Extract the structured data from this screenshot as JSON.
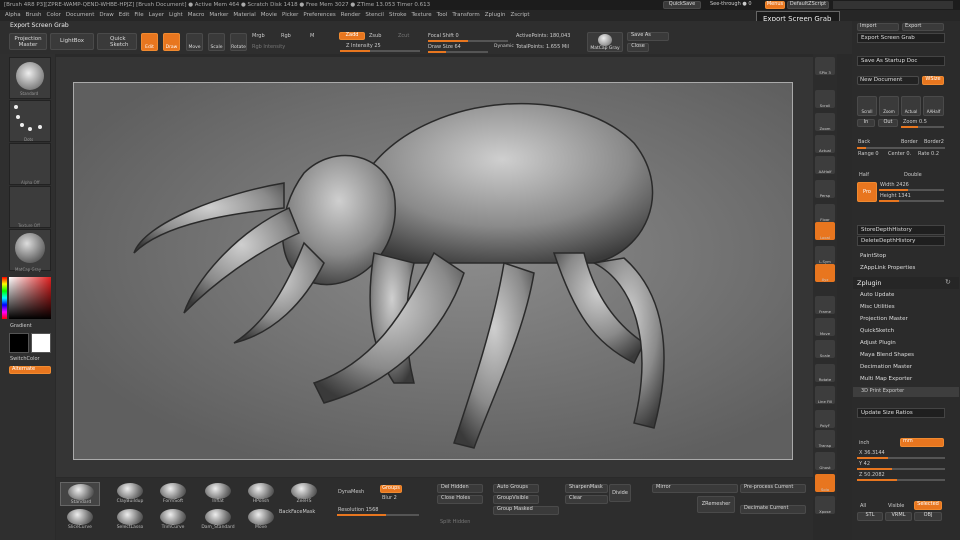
{
  "title_bar": "[Brush 4R8 P3][ZPRE-WAMP-QEND-WHBE-HPJZ]   [Brush Document]   ● Active Mem 464 ● Scratch Disk 1418 ● Free Mem 3027 ● ZTime 13.053 Timer 0.613",
  "menu": [
    "Alpha",
    "Brush",
    "Color",
    "Document",
    "Draw",
    "Edit",
    "File",
    "Layer",
    "Light",
    "Macro",
    "Marker",
    "Material",
    "Movie",
    "Picker",
    "Preferences",
    "Render",
    "Stencil",
    "Stroke",
    "Texture",
    "Tool",
    "Transform",
    "Zplugin",
    "Zscript"
  ],
  "top_right": {
    "quicksave": "QuickSave",
    "seethrough": "See-through ● 0",
    "menus": "Menus",
    "defaultzscript": "DefaultZScript",
    "lightbox": "LB"
  },
  "tooltip": "Export Screen Grab",
  "left_header": "Export Screen Grab",
  "toolbar": {
    "projection_master": "Projection Master",
    "lightbox": "LightBox",
    "quick_sketch": "Quick Sketch",
    "edit": "Edit",
    "draw": "Draw",
    "move": "Move",
    "scale": "Scale",
    "rotate": "Rotate",
    "mrgb": "Mrgb",
    "rgb": "Rgb",
    "m": "M",
    "rgb_intensity": "Rgb Intensity",
    "zadd": "Zadd",
    "zsub": "Zsub",
    "zcut": "Zcut",
    "z_intensity": "Z Intensity 25",
    "focal_shift": "Focal Shift 0",
    "draw_size": "Draw Size 64",
    "dynamic": "Dynamic",
    "active_points": "ActivePoints: 180,043",
    "total_points": "TotalPoints: 1.655 Mil",
    "matcap": "MatCap Gray",
    "save_as": "Save As",
    "close": "Close"
  },
  "left_panel": {
    "brush_label": "Standard",
    "stroke_label": "Dots",
    "alpha_label": "Alpha Off",
    "texture_label": "Texture Off",
    "material_label": "MatCap Gray",
    "gradient": "Gradient",
    "switch_color": "SwitchColor",
    "alternate": "Alternate"
  },
  "right_tools": [
    "SPix 3",
    "Scroll",
    "Zoom",
    "Actual",
    "AAHalf",
    "Persp",
    "Floor",
    "Local",
    "L.Sym",
    "Xyz",
    "Frame",
    "Move",
    "Scale",
    "Rotate",
    "Line Fill",
    "PolyF",
    "Transp",
    "Ghost",
    "Solo",
    "Xpose"
  ],
  "right_panel": {
    "import": "Import",
    "export": "Export",
    "export_screen_grab": "Export Screen Grab",
    "save_as_startup": "Save As Startup Doc",
    "new_document": "New Document",
    "wsize": "WSize",
    "scroll": "Scroll",
    "zoom": "Zoom",
    "actual": "Actual",
    "aahalf": "AAHalf",
    "in": "In",
    "out": "Out",
    "zoom_val": "Zoom 0.5",
    "back": "Back",
    "border": "Border",
    "border2": "Border2",
    "range": "Range 0",
    "center": "Center 0.",
    "rate": "Rate 0.2",
    "half": "Half",
    "double": "Double",
    "pro": "Pro",
    "width": "Width 2426",
    "height": "Height 1341",
    "store_depth": "StoreDepthHistory",
    "delete_depth": "DeleteDepthHistory",
    "paint_stop": "PaintStop",
    "zapplink": "ZAppLink Properties",
    "zplugin": "Zplugin",
    "plugins": [
      "Auto Update",
      "Misc Utilities",
      "Projection Master",
      "QuickSketch",
      "Adjust Plugin",
      "Maya Blend Shapes",
      "Decimation Master",
      "Multi Map Exporter"
    ],
    "print_exporter": "3D Print Exporter",
    "update_size": "Update Size Ratios",
    "inch": "inch",
    "mm": "mm",
    "x_val": "X 36.3144",
    "y_val": "Y 42",
    "z_val": "Z 50.2082",
    "all": "All",
    "visible": "Visible",
    "selected": "Selected",
    "stl": "STL",
    "vrml": "VRML",
    "obj": "OBJ"
  },
  "bottom": {
    "brushes": [
      "Standard",
      "ClayBuildup",
      "FormSoft",
      "Inflat",
      "HPolish",
      "ZeeHS",
      "SliceCurve",
      "SelectLasso",
      "TrimCurve",
      "Dam_Standard",
      "Move"
    ],
    "dynamesh": "DynaMesh",
    "groups": "Groups",
    "blur": "Blur 2",
    "resolution": "Resolution 1568",
    "rackface": "BackFaceMask",
    "del_hidden": "Del Hidden",
    "close_holes": "Close Holes",
    "split_hidden": "Split Hidden",
    "auto_groups": "Auto Groups",
    "group_visible": "GroupVisible",
    "group_masked": "Group Masked",
    "sharpen_mask": "SharpenMask",
    "clear": "Clear",
    "divide": "Divide",
    "mirror": "Mirror",
    "preprocess": "Pre-process Current",
    "zremesher": "ZRemesher",
    "decimate": "Decimate Current"
  },
  "colors": {
    "accent": "#e8761f",
    "bg": "#2a2a2a",
    "canvas": "#7a7a7a"
  }
}
